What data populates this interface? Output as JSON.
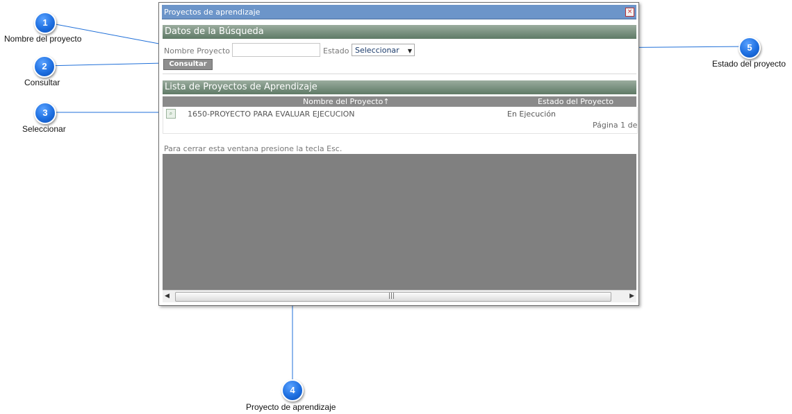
{
  "window": {
    "title": "Proyectos de aprendizaje",
    "close_glyph": "×"
  },
  "search_section": {
    "title": "Datos de la Búsqueda",
    "project_name_label": "Nombre Proyecto",
    "project_name_value": "",
    "state_label": "Estado",
    "state_selected": "Seleccionar",
    "consult_button": "Consultar"
  },
  "list_section": {
    "title": "Lista de Proyectos de Aprendizaje",
    "columns": [
      "Nombre del Proyecto↑",
      "Estado del Proyecto"
    ],
    "rows": [
      {
        "icon": "magnifier-icon",
        "name": "1650-PROYECTO PARA EVALUAR EJECUCION",
        "state": "En Ejecución"
      }
    ],
    "pager": "Página 1 de"
  },
  "footer_note": "Para cerrar esta ventana presione la tecla Esc.",
  "callouts": [
    {
      "number": "1",
      "label": "Nombre del proyecto"
    },
    {
      "number": "2",
      "label": "Consultar"
    },
    {
      "number": "3",
      "label": "Seleccionar"
    },
    {
      "number": "4",
      "label": "Proyecto de aprendizaje"
    },
    {
      "number": "5",
      "label": "Estado del proyecto"
    }
  ],
  "colors": {
    "titlebar": "#6c95c9",
    "section_header": "#5f7a66",
    "grid_header": "#8a8a8a",
    "callout_bubble": "#1e6fe0",
    "callout_line": "#1f6fd8",
    "empty_area": "#808080"
  }
}
